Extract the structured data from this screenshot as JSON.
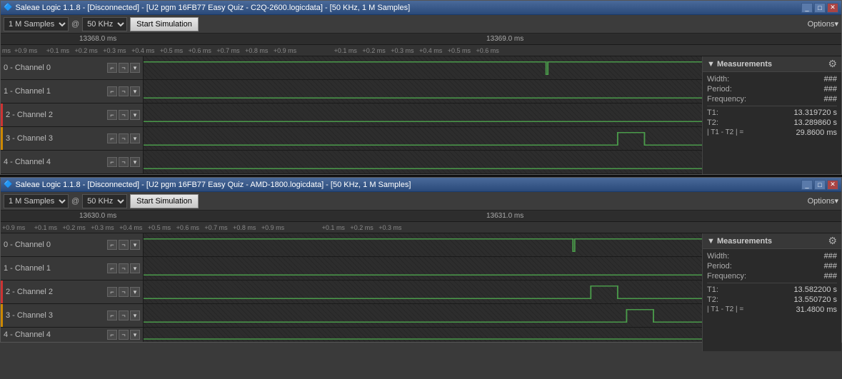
{
  "window1": {
    "title": "Saleae Logic 1.1.8 - [Disconnected] - [U2 pgm 16FB77 Easy Quiz - C2Q-2600.logicdata] - [50 KHz, 1 M Samples]",
    "samples": "1 M Samples",
    "freq": "50 KHz",
    "sim_btn": "Start Simulation",
    "options_label": "Options▾",
    "time_left": "13368.0 ms",
    "time_right": "13369.0 ms",
    "ticks_left": "ms +0.9 ms   +0.1 ms  +0.2 ms  +0.3 ms  +0.4 ms  +0.5 ms  +0.6 ms  +0.7 ms  +0.8 ms  +0.9 ms",
    "ticks_right": "+0.1 ms  +0.2 ms  +0.3 ms  +0.4 ms  +0.5 ms  +0.6 ms",
    "channels": [
      {
        "id": "0",
        "label": "0 - Channel 0",
        "color": "default"
      },
      {
        "id": "1",
        "label": "1 - Channel 1",
        "color": "default"
      },
      {
        "id": "2",
        "label": "2 - Channel 2",
        "color": "red"
      },
      {
        "id": "3",
        "label": "3 - Channel 3",
        "color": "orange"
      },
      {
        "id": "4",
        "label": "4 - Channel 4",
        "color": "default"
      }
    ],
    "measurements": {
      "title": "▼ Measurements",
      "gear_icon": "⚙",
      "width_label": "Width:",
      "width_value": "###",
      "period_label": "Period:",
      "period_value": "###",
      "freq_label": "Frequency:",
      "freq_value": "###",
      "t1_label": "T1:",
      "t1_value": "13.319720 s",
      "t2_label": "T2:",
      "t2_value": "13.289860 s",
      "diff_label": "| T1 - T2 | =",
      "diff_value": "29.8600 ms"
    }
  },
  "window2": {
    "title": "Saleae Logic 1.1.8 - [Disconnected] - [U2 pgm 16FB77 Easy Quiz - AMD-1800.logicdata] - [50 KHz, 1 M Samples]",
    "samples": "1 M Samples",
    "freq": "50 KHz",
    "sim_btn": "Start Simulation",
    "options_label": "Options▾",
    "time_left": "13630.0 ms",
    "time_right": "13631.0 ms",
    "ticks_left": "+0.9 ms   +0.1 ms  +0.2 ms  +0.3 ms  +0.4 ms  +0.5 ms  +0.6 ms  +0.7 ms  +0.8 ms  +0.9 ms",
    "ticks_right": "+0.1 ms  +0.2 ms  +0.3 ms",
    "channels": [
      {
        "id": "0",
        "label": "0 - Channel 0",
        "color": "default"
      },
      {
        "id": "1",
        "label": "1 - Channel 1",
        "color": "default"
      },
      {
        "id": "2",
        "label": "2 - Channel 2",
        "color": "red"
      },
      {
        "id": "3",
        "label": "3 - Channel 3",
        "color": "orange"
      },
      {
        "id": "4",
        "label": "4 - Channel 4",
        "color": "default"
      }
    ],
    "measurements": {
      "title": "▼ Measurements",
      "gear_icon": "⚙",
      "width_label": "Width:",
      "width_value": "###",
      "period_label": "Period:",
      "period_value": "###",
      "freq_label": "Frequency:",
      "freq_value": "###",
      "t1_label": "T1:",
      "t1_value": "13.582200 s",
      "t2_label": "T2:",
      "t2_value": "13.550720 s",
      "diff_label": "| T1 - T2 | =",
      "diff_value": "31.4800 ms"
    }
  }
}
